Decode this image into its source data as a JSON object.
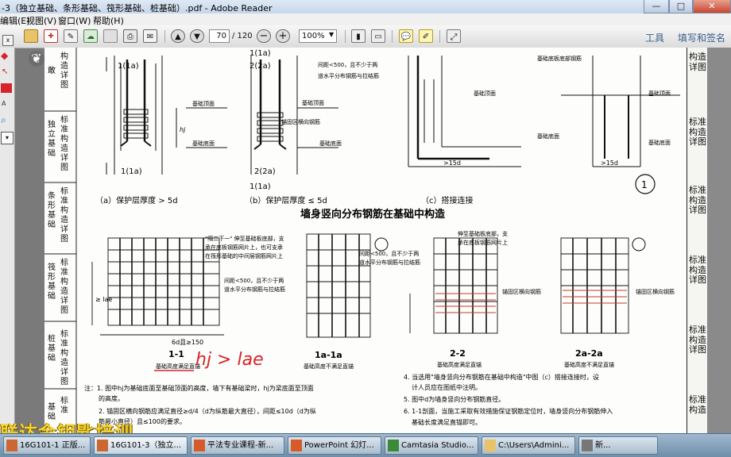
{
  "window": {
    "title": "-3（独立基础、条形基础、筏形基础、桩基础）.pdf - Adobe Reader"
  },
  "menu": [
    "编辑(E)",
    "视图(V)",
    "窗口(W)",
    "帮助(H)"
  ],
  "toolbar": {
    "page_current": "70",
    "page_total": "/ 120",
    "zoom": "100%",
    "tools_label": "工具",
    "sign_label": "填写和签名"
  },
  "left_overlay": {
    "label": "建"
  },
  "sidebar_tabs": [
    {
      "label": "构造详图"
    },
    {
      "label": "标准构造详图"
    },
    {
      "label": "标准构造详图"
    },
    {
      "label": "标准构造详图"
    },
    {
      "label": "标准构造详图"
    },
    {
      "label": "标准构造"
    }
  ],
  "page_left_tabs": [
    {
      "label": "构造详图"
    },
    {
      "label": "标准构造详图"
    },
    {
      "label": "标准构造详图"
    },
    {
      "label": "标准构造详图"
    },
    {
      "label": "标准构造详图"
    },
    {
      "label": "标准"
    }
  ],
  "page_left_categories": [
    "独立基础",
    "条形基础",
    "筏形基础",
    "桩基础",
    "基础"
  ],
  "drawing": {
    "top_labels": {
      "a_section": "1(1a)",
      "a_section_bottom": "1(1a)",
      "b_section_top1": "1(1a)",
      "b_section_top2": "2(2a)",
      "b_section_bottom": "2(2a)",
      "b_section_bottom2": "1(1a)",
      "base_top": "基础顶面",
      "base_bottom": "基础底面",
      "anchor_zone": "锚固区横向钢筋",
      "spacing_note_1": "间距<500，且不少于两",
      "spacing_note_2": "道水平分布钢筋与拉结筋",
      "base_plate_bars": "基础底板底部钢筋",
      "embed_note": "墙外侧竖向钢筋",
      "lap": ">15d",
      "cap_a": "（a）保护层厚度 > 5d",
      "cap_b": "（b）保护层厚度 ≤ 5d",
      "cap_c": "（c）搭接连接",
      "circle_num": "1"
    },
    "section_title": "墙身竖向分布钢筋在基础中构造",
    "mid_labels": {
      "note_a_1": "\"隔二下一\" 伸至基础板底部，支",
      "note_a_2": "承在底板钢筋网片上，也可支承",
      "note_a_3": "在筏形基础的中间层钢筋网片上",
      "spacing_1": "间距<500，且不少于两",
      "spacing_2": "道水平分布钢筋与拉结筋",
      "note_c_1": "伸至基础板底部，支",
      "note_c_2": "承在底板钢筋网片上",
      "anchor": "锚固区横向钢筋",
      "lae": "≥ lae",
      "dim_6d": "6d且≥150",
      "hj": "hj"
    },
    "section_captions": [
      {
        "name": "1-1",
        "sub": "基础高度满足直锚"
      },
      {
        "name": "1a-1a",
        "sub": "基础高度不满足直锚"
      },
      {
        "name": "2-2",
        "sub": "基础高度满足直锚"
      },
      {
        "name": "2a-2a",
        "sub": "基础高度不满足直锚"
      }
    ],
    "handwriting": "hj > lae",
    "notes_left": [
      "注：1. 图中hj为基础底面至基础顶面的高度，墙下有基础梁时，hj为梁底面至顶面",
      "的高度。",
      "2. 锚固区横向钢筋应满足直径≥d/4（d为纵筋最大直径），间距≤10d（d为纵",
      "筋最小直径）且≤100的要求。"
    ],
    "notes_right": [
      "4. 当选用\"墙身竖向分布钢筋在基础中构造\"中图（c）搭接连接时，设",
      "计人员应在图纸中注明。",
      "5. 图中d为墙身竖向分布钢筋直径。",
      "6. 1-1剖面，当施工采取有效措施保证钢筋定位时，墙身竖向分布钢筋伸入",
      "基础长度满足直锚即可。"
    ]
  },
  "watermark": "联达金钥匙培训",
  "taskbar": [
    {
      "label": "16G101-1 正版..."
    },
    {
      "label": "16G101-3（独立..."
    },
    {
      "label": "平法专业课程-新..."
    },
    {
      "label": "PowerPoint 幻灯..."
    },
    {
      "label": "Camtasia Studio..."
    },
    {
      "label": "C:\\Users\\Admini..."
    },
    {
      "label": "新..."
    }
  ],
  "colors": {
    "accent_red": "#d8232a",
    "titlebar": "#c5d6ea",
    "taskbar": "#7f9cb6",
    "watermark": "#f4d32a"
  }
}
